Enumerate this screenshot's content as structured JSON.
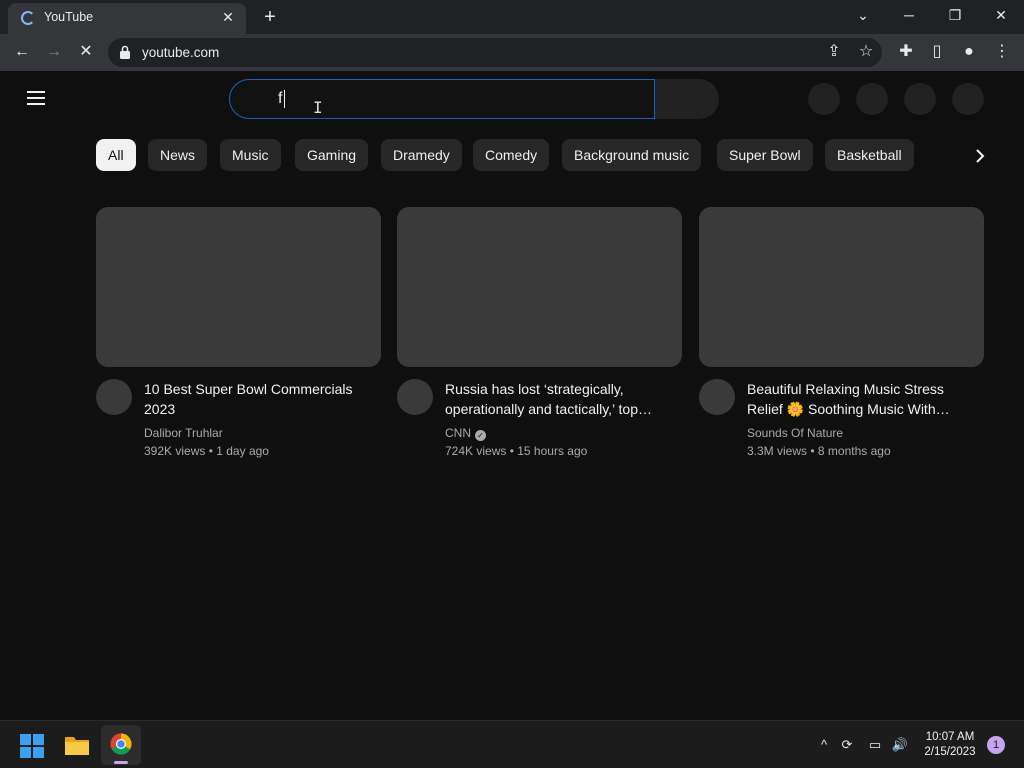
{
  "browser": {
    "tab_title": "YouTube",
    "url": "youtube.com",
    "accent": "#8ab4f8"
  },
  "youtube": {
    "search_value": "f",
    "chips": [
      "All",
      "News",
      "Music",
      "Gaming",
      "Dramedy",
      "Comedy",
      "Background music",
      "Super Bowl",
      "Basketball"
    ],
    "active_chip": "All",
    "videos": [
      {
        "title": "10 Best Super Bowl Commercials 2023",
        "channel": "Dalibor Truhlar",
        "verified": false,
        "views": "392K views",
        "age": "1 day ago"
      },
      {
        "title": "Russia has lost ‘strategically, operationally and tactically,’ top…",
        "channel": "CNN",
        "verified": true,
        "views": "724K views",
        "age": "15 hours ago"
      },
      {
        "title": "Beautiful Relaxing Music Stress Relief 🌼 Soothing Music With…",
        "channel": "Sounds Of Nature",
        "verified": false,
        "views": "3.3M views",
        "age": "8 months ago"
      }
    ]
  },
  "taskbar": {
    "time": "10:07 AM",
    "date": "2/15/2023",
    "notification_count": "1"
  }
}
